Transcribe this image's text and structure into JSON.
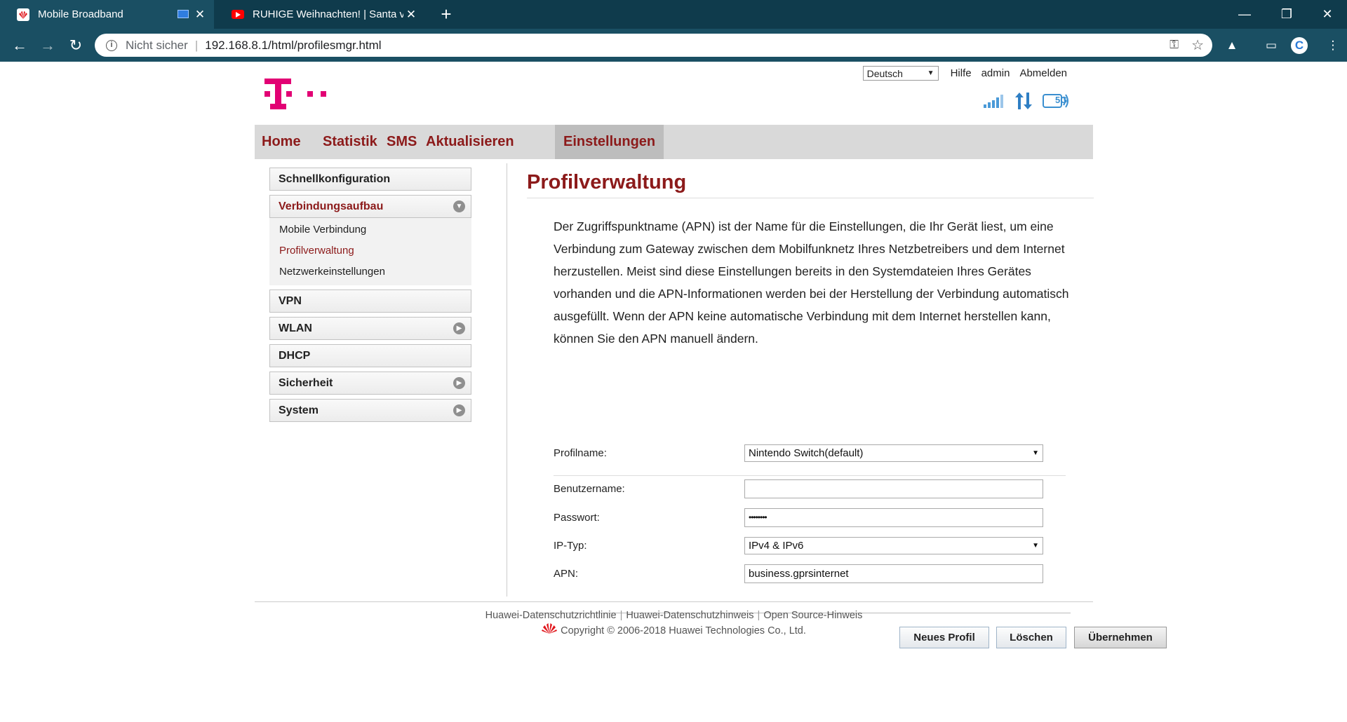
{
  "browser": {
    "tabs": [
      {
        "title": "Mobile Broadband"
      },
      {
        "title": "RUHIGE Weihnachten! | Santa vs"
      }
    ],
    "address": {
      "security_label": "Nicht sicher",
      "url": "192.168.8.1/html/profilesmgr.html"
    }
  },
  "header": {
    "language": "Deutsch",
    "links": {
      "help": "Hilfe",
      "user": "admin",
      "logout": "Abmelden"
    },
    "network_badge": "5G"
  },
  "mainnav": [
    {
      "label": "Home"
    },
    {
      "label": "Statistik"
    },
    {
      "label": "SMS"
    },
    {
      "label": "Aktualisieren"
    },
    {
      "label": "Einstellungen",
      "active": true
    }
  ],
  "sidebar": {
    "items": [
      {
        "label": "Schnellkonfiguration"
      },
      {
        "label": "Verbindungsaufbau",
        "expanded": true
      },
      {
        "label": "VPN"
      },
      {
        "label": "WLAN"
      },
      {
        "label": "DHCP"
      },
      {
        "label": "Sicherheit"
      },
      {
        "label": "System"
      }
    ],
    "subitems": [
      {
        "label": "Mobile Verbindung"
      },
      {
        "label": "Profilverwaltung",
        "active": true
      },
      {
        "label": "Netzwerkeinstellungen"
      }
    ]
  },
  "content": {
    "title": "Profilverwaltung",
    "description": "Der Zugriffspunktname (APN) ist der Name für die Einstellungen, die Ihr Gerät liest, um eine Verbindung zum Gateway zwischen dem Mobilfunknetz Ihres Netzbetreibers und dem Internet herzustellen. Meist sind diese Einstellungen bereits in den Systemdateien Ihres Gerätes vorhanden und die APN-Informationen werden bei der Herstellung der Verbindung automatisch ausgefüllt. Wenn der APN keine automatische Verbindung mit dem Internet herstellen kann, können Sie den APN manuell ändern.",
    "form": {
      "profile_label": "Profilname:",
      "profile_value": "Nintendo Switch(default)",
      "username_label": "Benutzername:",
      "username_value": "",
      "password_label": "Passwort:",
      "password_value": "••••••••",
      "iptype_label": "IP-Typ:",
      "iptype_value": "IPv4 & IPv6",
      "apn_label": "APN:",
      "apn_value": "business.gprsinternet"
    },
    "buttons": {
      "new": "Neues Profil",
      "delete": "Löschen",
      "apply": "Übernehmen"
    }
  },
  "footer": {
    "links": [
      "Huawei-Datenschutzrichtlinie",
      "Huawei-Datenschutzhinweis",
      "Open Source-Hinweis"
    ],
    "copyright": "Copyright © 2006-2018 Huawei Technologies Co., Ltd."
  },
  "colors": {
    "brand_magenta": "#e20074",
    "accent_red": "#8c1a1a",
    "chrome_dark": "#0f3b4c",
    "chrome_toolbar": "#1a4f63",
    "status_blue": "#3a8fd0"
  }
}
